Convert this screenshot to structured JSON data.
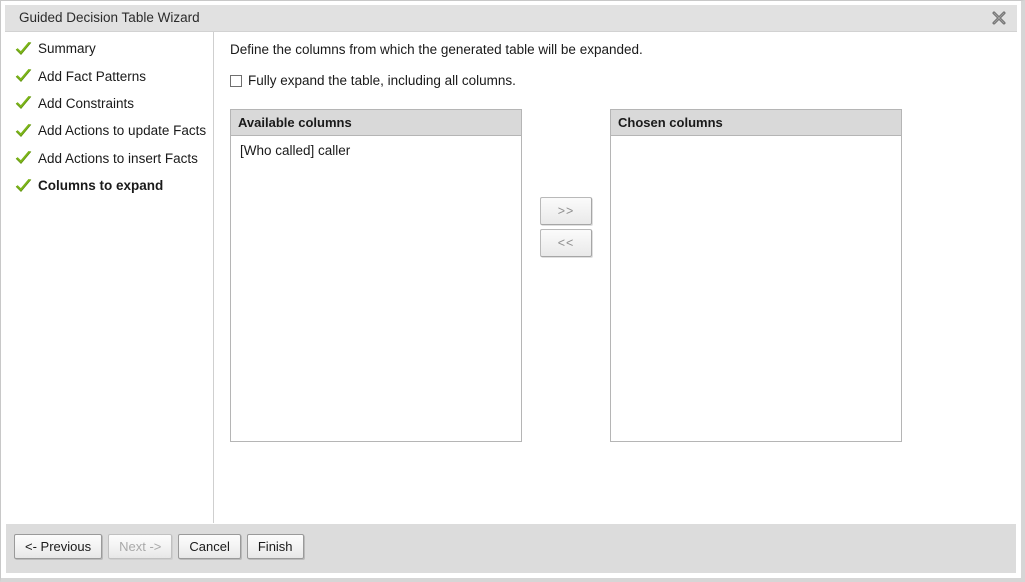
{
  "window": {
    "title": "Guided Decision Table Wizard",
    "close_icon": "close-icon"
  },
  "sidebar": {
    "steps": [
      {
        "label": "Summary",
        "icon": "check-icon",
        "current": false
      },
      {
        "label": "Add Fact Patterns",
        "icon": "check-icon",
        "current": false
      },
      {
        "label": "Add Constraints",
        "icon": "check-icon",
        "current": false
      },
      {
        "label": "Add Actions to update Facts",
        "icon": "check-icon",
        "current": false
      },
      {
        "label": "Add Actions to insert Facts",
        "icon": "check-icon",
        "current": false
      },
      {
        "label": "Columns to expand",
        "icon": "check-icon",
        "current": true
      }
    ]
  },
  "main": {
    "intro": "Define the columns from which the generated table will be expanded.",
    "full_expand": {
      "label": "Fully expand the table, including all columns.",
      "checked": false
    },
    "available": {
      "header": "Available columns",
      "items": [
        "[Who called] caller"
      ]
    },
    "chosen": {
      "header": "Chosen columns",
      "items": []
    },
    "transfer": {
      "add_label": ">>",
      "remove_label": "<<"
    }
  },
  "footer": {
    "buttons": [
      {
        "label": "<- Previous",
        "disabled": false
      },
      {
        "label": "Next ->",
        "disabled": true
      },
      {
        "label": "Cancel",
        "disabled": false
      },
      {
        "label": "Finish",
        "disabled": false
      }
    ]
  },
  "colors": {
    "check_green": "#7cb518",
    "titlebar_bg": "#e1e1e1",
    "footer_bg": "#dcdcdc",
    "listheader_bg": "#d9d9d9"
  }
}
